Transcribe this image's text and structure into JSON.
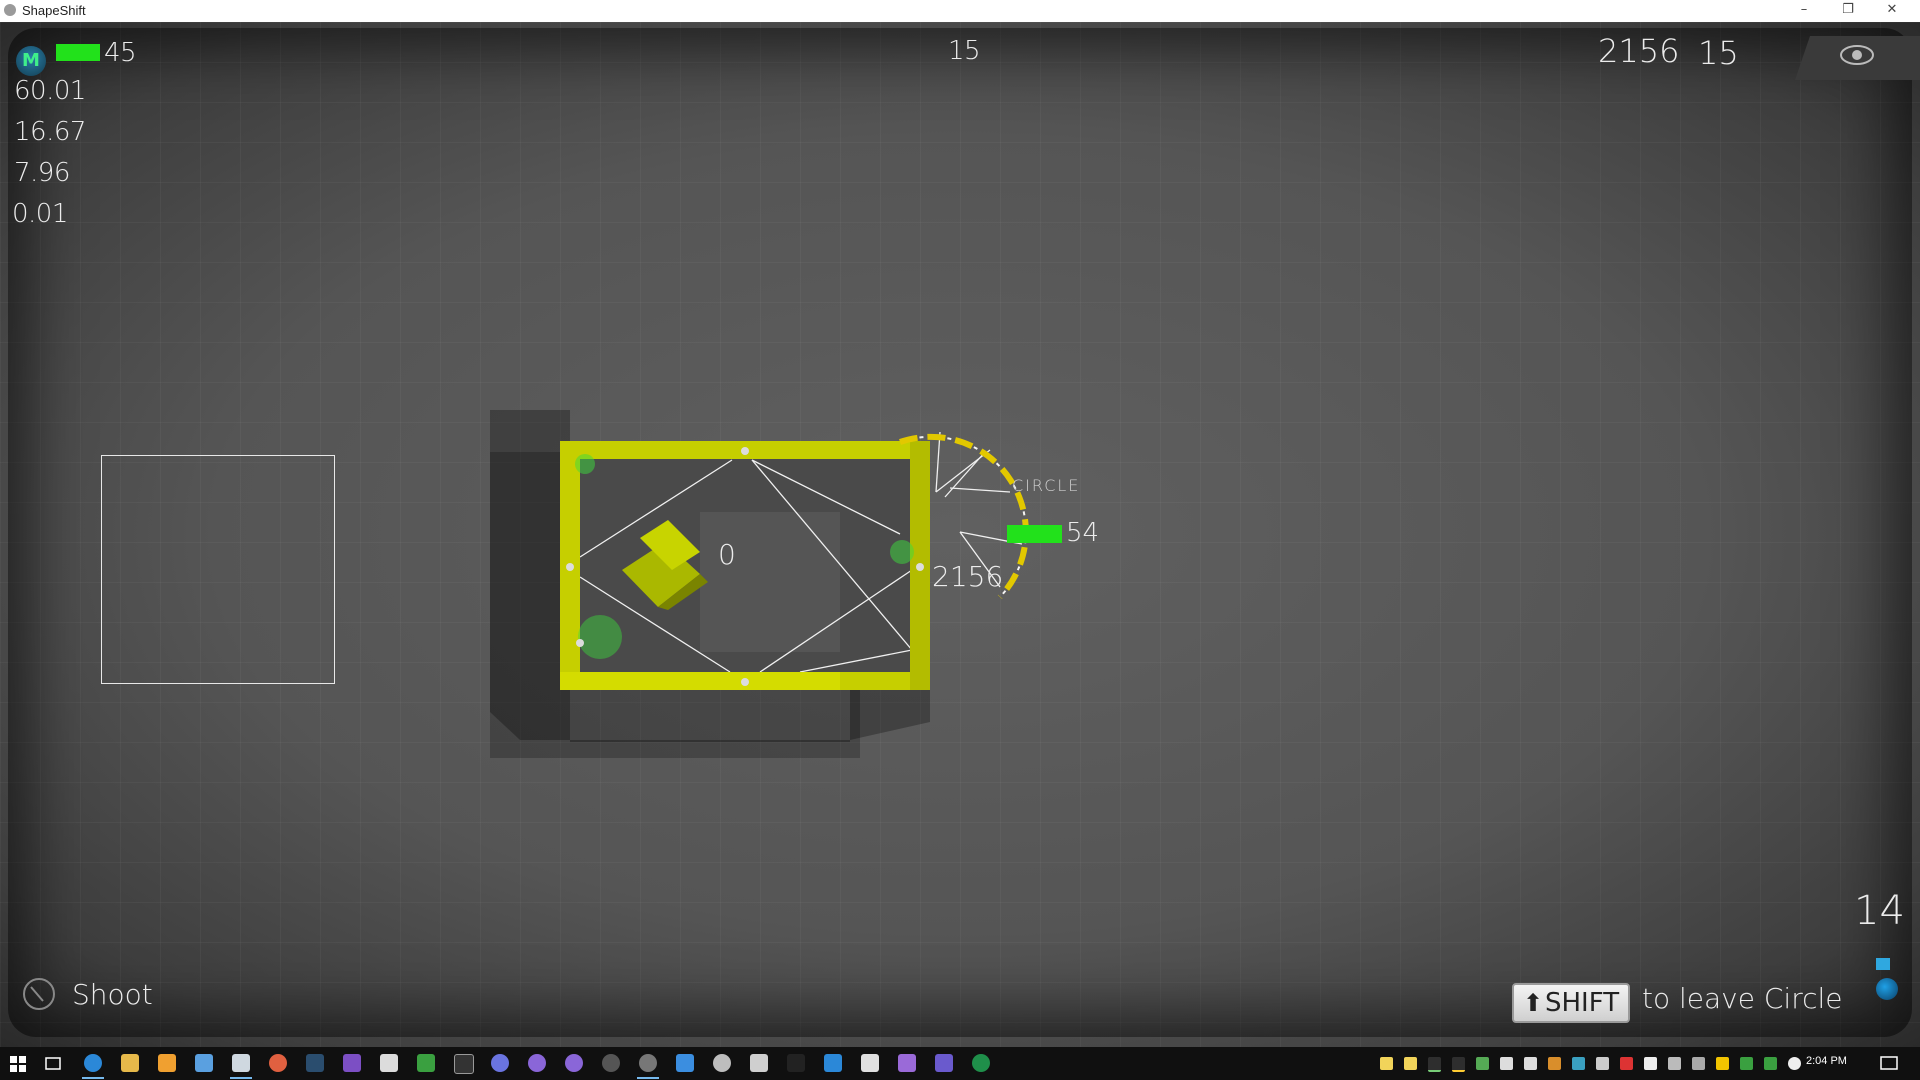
{
  "window": {
    "title": "ShapeShift",
    "minimize_glyph": "–",
    "restore_glyph": "❐",
    "close_glyph": "✕"
  },
  "hud": {
    "badge_letter": "M",
    "player_health": "45",
    "player_health_fill": 1.0,
    "stats": [
      "60.01",
      "16.67",
      "7.96",
      "0.01"
    ],
    "top_center_value": "15",
    "score": "2156",
    "top_right_value": "15",
    "bottom_right_value": "14",
    "shoot_label": "Shoot",
    "shift_key_label": "SHIFT",
    "hint_text": "to leave Circle",
    "eye_icon": "eye-icon"
  },
  "scene": {
    "enemy_count_label": "0",
    "circle_label": "CIRCLE",
    "circle_health": "54",
    "circle_score": "2156",
    "accent_yellow": "#c8d400",
    "health_green": "#22e11b"
  },
  "taskbar": {
    "clock": "2:04 PM",
    "start_icon": "windows-logo-icon",
    "task_view_icon": "task-view-icon"
  }
}
